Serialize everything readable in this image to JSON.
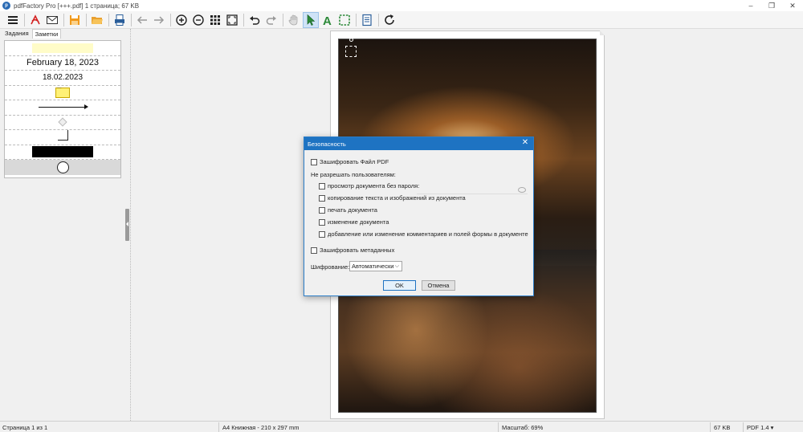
{
  "window": {
    "title": "pdfFactory Pro [+++.pdf] 1 страница; 67 KB",
    "app_icon": "pdffactory-logo-icon",
    "controls": [
      "–",
      "❐",
      "✕"
    ]
  },
  "toolbar": {
    "buttons": [
      "menu-icon",
      "pdf-icon",
      "email-icon",
      "save-icon",
      "open-folder-icon",
      "print-icon",
      "back-arrow-icon",
      "forward-arrow-icon",
      "zoom-in-icon",
      "zoom-out-icon",
      "thumbnails-icon",
      "fit-page-icon",
      "undo-icon",
      "redo-icon",
      "hand-tool-icon",
      "select-pointer-icon",
      "text-tool-icon",
      "area-select-icon",
      "notes-icon",
      "refresh-icon"
    ],
    "active": "select-pointer-icon"
  },
  "left_panel": {
    "tabs": [
      "Задания",
      "Заметки"
    ],
    "selected_tab": "Заметки",
    "notes": {
      "date_long": "February 18, 2023",
      "date_short": "18.02.2023"
    }
  },
  "dialog": {
    "title": "Безопасность",
    "encrypt_pdf": "Зашифровать Файл PDF",
    "disallow_header": "Не разрешать пользователям:",
    "options": [
      "просмотр документа без пароля:",
      "копирование текста и изображений из документа",
      "печать документа",
      "изменение документа",
      "добавление или изменение комментариев и полей формы в документе"
    ],
    "encrypt_metadata": "Зашифровать метаданных",
    "encryption_label": "Шифрование:",
    "encryption_value": "Автоматически",
    "ok": "OK",
    "cancel": "Отмена"
  },
  "statusbar": {
    "page": "Страница 1 из 1",
    "paper": "A4 Книжная - 210 x 297 mm",
    "zoom": "Масштаб: 69%",
    "size": "67 KB",
    "pdf_version": "PDF 1.4 ▾"
  }
}
